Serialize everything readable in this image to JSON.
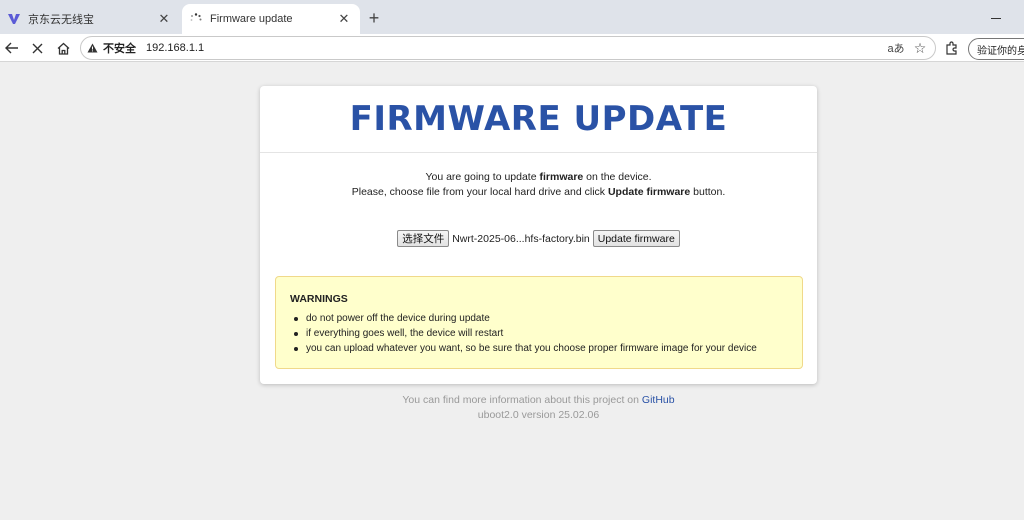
{
  "browser": {
    "tabs": [
      {
        "title": "京东云无线宝",
        "active": false
      },
      {
        "title": "Firmware update",
        "active": true
      }
    ],
    "omnibox": {
      "security_label": "不安全",
      "url": "192.168.1.1",
      "translate_glyph": "aあ",
      "star_glyph": "☆"
    },
    "profile_label": "验证你的身份"
  },
  "page": {
    "title": "FIRMWARE UPDATE",
    "intro": {
      "line1_pre": "You are going to update ",
      "line1_bold": "firmware",
      "line1_post": " on the device.",
      "line2_pre": "Please, choose file from your local hard drive and click ",
      "line2_bold": "Update firmware",
      "line2_post": " button."
    },
    "file_input": {
      "choose_label": "选择文件",
      "file_name": "Nwrt-2025-06...hfs-factory.bin"
    },
    "update_button_label": "Update firmware",
    "warnings": {
      "title": "WARNINGS",
      "items": [
        "do not power off the device during update",
        "if everything goes well, the device will restart",
        "you can upload whatever you want, so be sure that you choose proper firmware image for your device"
      ]
    },
    "footer": {
      "info_pre": "You can find more information about this project on ",
      "link_label": "GitHub",
      "version": "uboot2.0 version 25.02.06"
    }
  },
  "colors": {
    "title_blue": "#2a52a6",
    "warning_bg": "#ffffcc"
  }
}
